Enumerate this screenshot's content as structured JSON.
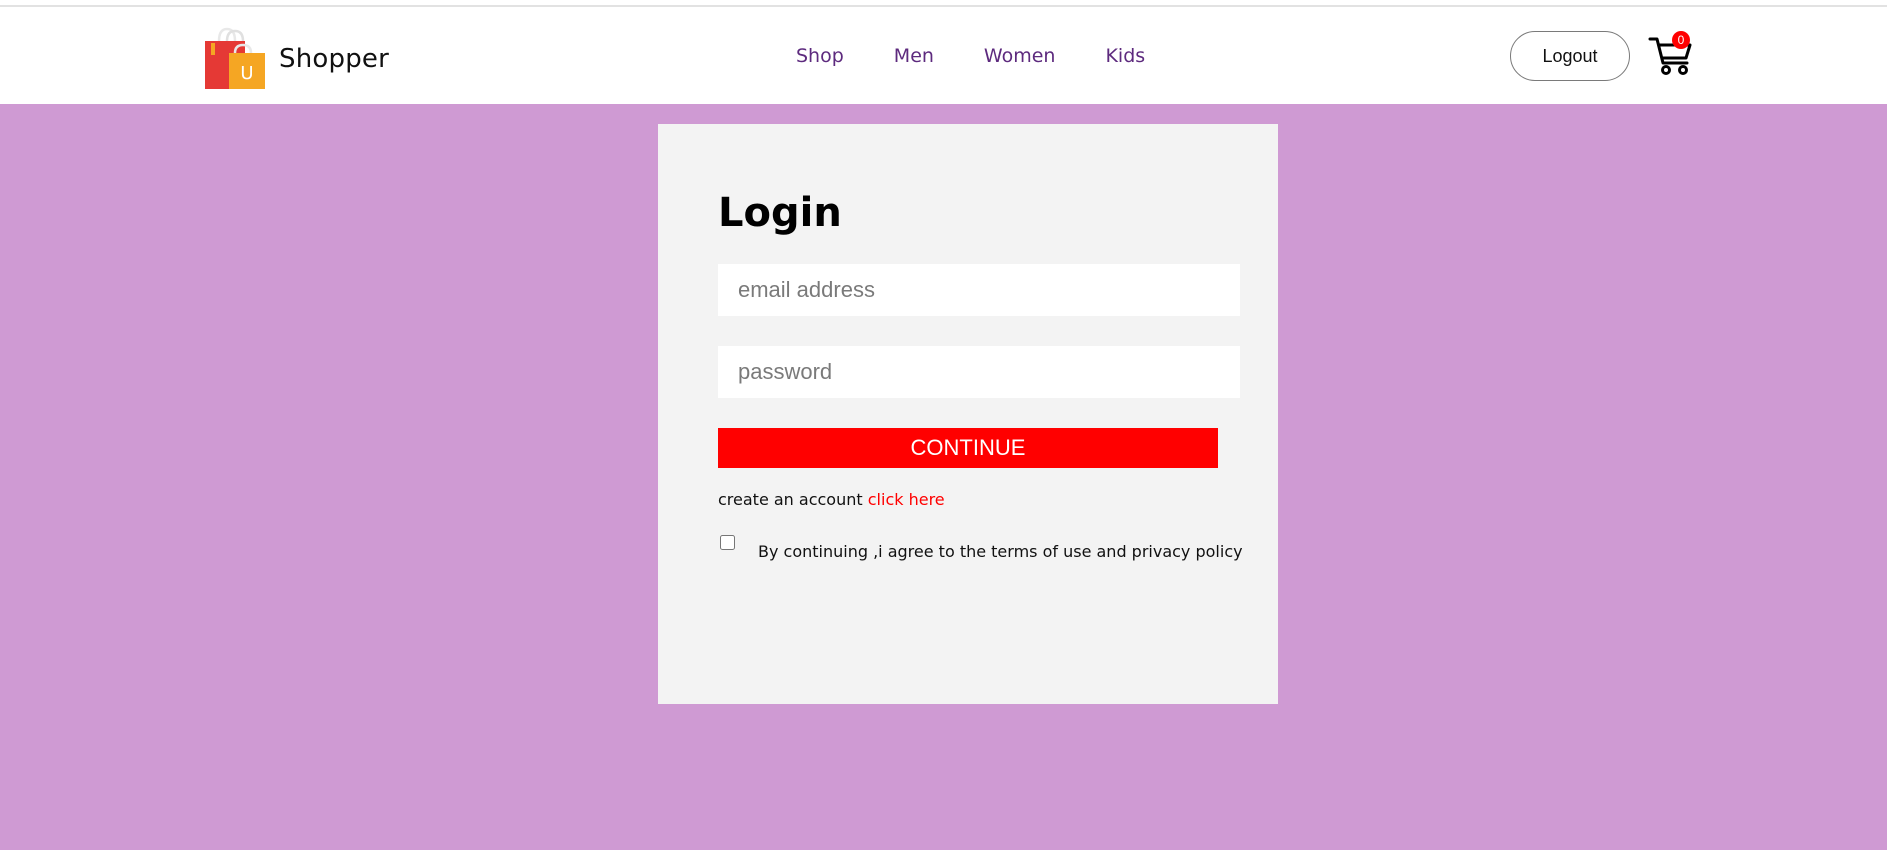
{
  "brand": {
    "name": "Shopper",
    "logo_letter": "U",
    "colors": {
      "bag_back": "#e53935",
      "bag_front": "#f5a623"
    }
  },
  "nav": {
    "items": [
      {
        "label": "Shop"
      },
      {
        "label": "Men"
      },
      {
        "label": "Women"
      },
      {
        "label": "Kids"
      }
    ],
    "link_color": "#5d2a7e"
  },
  "header": {
    "logout_label": "Logout",
    "cart": {
      "icon": "cart-icon",
      "count": "0"
    }
  },
  "login": {
    "title": "Login",
    "email_placeholder": "email address",
    "password_placeholder": "password",
    "continue_label": "CONTINUE",
    "signup_text": "create an account",
    "signup_link": "click here",
    "agree_text": "By continuing ,i agree to the terms of use and privacy policy"
  },
  "theme": {
    "page_background": "#cf9ad3",
    "card_background": "#f3f3f3",
    "accent": "#ff0000"
  }
}
